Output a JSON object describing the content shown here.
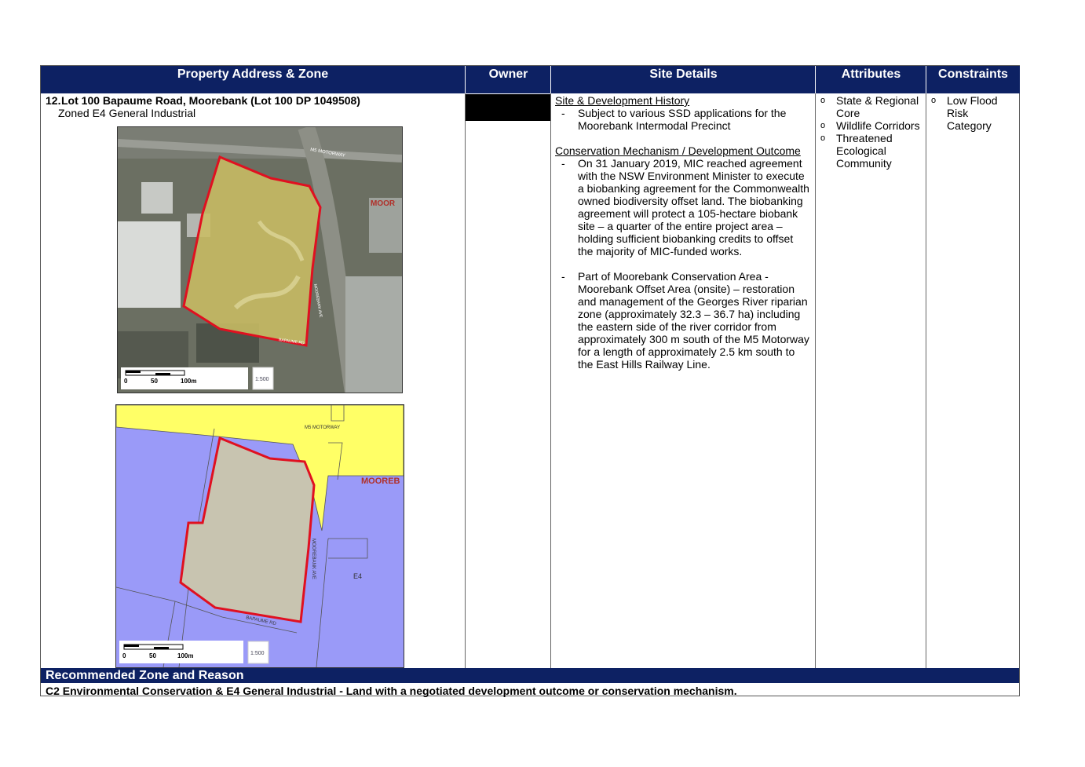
{
  "headers": {
    "address": "Property Address & Zone",
    "owner": "Owner",
    "site_details": "Site Details",
    "attributes": "Attributes",
    "constraints": "Constraints"
  },
  "property": {
    "number": "12.",
    "title": "Lot 100 Bapaume Road, Moorebank (Lot 100 DP 1049508)",
    "zone": "Zoned E4 General Industrial"
  },
  "aerial_map": {
    "labels": {
      "motorway": "M5 MOTORWAY",
      "suburb": "MOOR",
      "road_ave": "MOOREBANK AVE",
      "road_bap": "BAPAUME RD"
    },
    "scale": {
      "ticks": [
        "0",
        "50",
        "100m"
      ],
      "ratio": "1:500"
    }
  },
  "zoning_map": {
    "labels": {
      "motorway": "M5 MOTORWAY",
      "suburb": "MOOREB",
      "road_ave": "MOOREBANK AVE",
      "road_bap": "BAPAUME RD",
      "zone": "E4"
    },
    "scale": {
      "ticks": [
        "0",
        "50",
        "100m"
      ],
      "ratio": "1:500"
    },
    "colors": {
      "industrial": "#9a9af8",
      "road": "#ffff66",
      "site": "#c8c4b0",
      "boundary": "#e01020"
    }
  },
  "site_details": {
    "history_heading": "Site & Development History",
    "history_items": [
      [
        "Subject to various SSD applications for the",
        "Moorebank Intermodal Precinct"
      ]
    ],
    "conservation_heading": "Conservation Mechanism / Development Outcome",
    "conservation_items": [
      [
        "On 31 January 2019, MIC reached agreement",
        "with the NSW Environment Minister to execute",
        "a biobanking agreement for the Commonwealth",
        "owned biodiversity offset land. The biobanking",
        "agreement will protect a 105-hectare biobank",
        "site – a quarter of the entire project area –",
        "holding sufficient biobanking credits to offset",
        "the majority of MIC-funded works."
      ],
      [
        "Part of Moorebank Conservation Area -",
        "Moorebank Offset Area (onsite) – restoration",
        "and management of the Georges River riparian",
        "zone (approximately 32.3 – 36.7 ha) including",
        "the eastern side of the river corridor from",
        "approximately 300 m south of the M5 Motorway",
        "for a length of approximately 2.5 km south to",
        "the East Hills Railway Line."
      ]
    ]
  },
  "attributes": [
    [
      "State & Regional",
      "Core"
    ],
    [
      "Wildlife Corridors"
    ],
    [
      "Threatened",
      "Ecological",
      "Community"
    ]
  ],
  "constraints": [
    [
      "Low Flood",
      "Risk",
      "Category"
    ]
  ],
  "recommendation": {
    "heading": "Recommended Zone and Reason",
    "text": "C2 Environmental Conservation & E4 General Industrial - Land with a negotiated development outcome or conservation mechanism."
  },
  "colors": {
    "header_bg": "#0d2163",
    "redacted": "#000000"
  }
}
